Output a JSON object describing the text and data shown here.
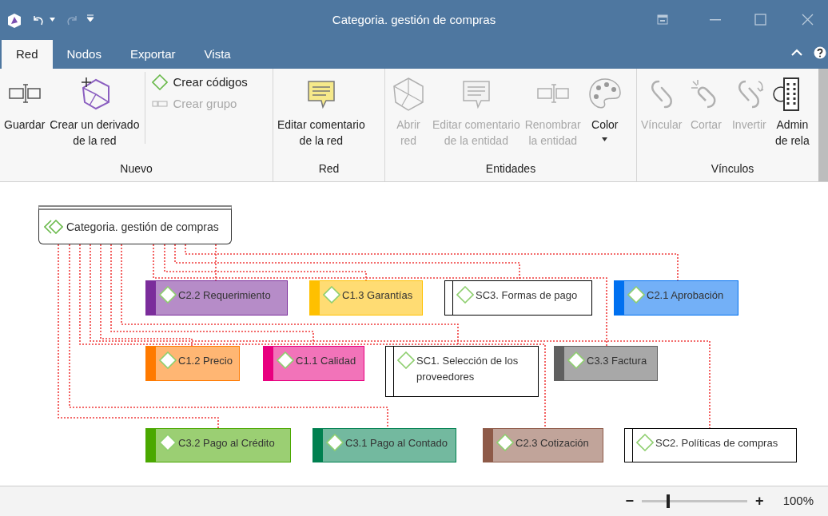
{
  "window": {
    "title": "Categoria. gestión de compras"
  },
  "tabs": [
    {
      "label": "Red",
      "selected": true
    },
    {
      "label": "Nodos",
      "selected": false
    },
    {
      "label": "Exportar",
      "selected": false
    },
    {
      "label": "Vista",
      "selected": false
    }
  ],
  "ribbon": {
    "groups": [
      {
        "label": "Nuevo",
        "buttons": [
          {
            "label": "Guardar",
            "kind": "large",
            "disabled": false
          },
          {
            "label": "Crear un derivado\nde la red",
            "kind": "large",
            "disabled": false
          },
          {
            "label": "Crear códigos",
            "kind": "small",
            "disabled": false
          },
          {
            "label": "Crear grupo",
            "kind": "small",
            "disabled": true
          }
        ]
      },
      {
        "label": "Red",
        "buttons": [
          {
            "label": "Editar comentario\nde la red",
            "kind": "large",
            "disabled": false
          }
        ]
      },
      {
        "label": "Entidades",
        "buttons": [
          {
            "label": "Abrir\nred",
            "kind": "large",
            "disabled": true
          },
          {
            "label": "Editar comentario\nde la entidad",
            "kind": "large",
            "disabled": true
          },
          {
            "label": "Renombrar\nla entidad",
            "kind": "large",
            "disabled": true
          },
          {
            "label": "Color",
            "kind": "dropdown",
            "disabled": false
          }
        ]
      },
      {
        "label": "Vínculos",
        "buttons": [
          {
            "label": "Víncular",
            "kind": "large",
            "disabled": true
          },
          {
            "label": "Cortar",
            "kind": "large",
            "disabled": true
          },
          {
            "label": "Invertir",
            "kind": "large",
            "disabled": true
          },
          {
            "label": "Admin\nde rela",
            "kind": "large",
            "disabled": false
          }
        ]
      }
    ]
  },
  "network": {
    "root": {
      "label": "Categoria. gestión de compras"
    },
    "nodes": [
      {
        "label": "C2.2 Requerimiento",
        "kind": "code",
        "color": "#7b2d9b"
      },
      {
        "label": "C1.3 Garantías",
        "kind": "code",
        "color": "#ffc000"
      },
      {
        "label": "SC3. Formas de pago",
        "kind": "group"
      },
      {
        "label": "C2.1 Aprobación",
        "kind": "code",
        "color": "#0070f0"
      },
      {
        "label": "C1.2 Precio",
        "kind": "code",
        "color": "#ff7a00"
      },
      {
        "label": "C1.1 Calidad",
        "kind": "code",
        "color": "#e8007f"
      },
      {
        "label": "SC1. Selección de los proveedores",
        "kind": "group"
      },
      {
        "label": "C3.3 Factura",
        "kind": "code",
        "color": "#606060"
      },
      {
        "label": "C3.2 Pago al Crédito",
        "kind": "code",
        "color": "#4aa800"
      },
      {
        "label": "C3.1 Pago al Contado",
        "kind": "code",
        "color": "#008050"
      },
      {
        "label": "C2.3 Cotización",
        "kind": "code",
        "color": "#8e5a48"
      },
      {
        "label": "SC2. Políticas de compras",
        "kind": "group"
      }
    ]
  },
  "status_bar": {
    "zoom_out": "−",
    "zoom_in": "+",
    "zoom": {
      "level": 0.25
    },
    "zoom_reading": "100%"
  }
}
